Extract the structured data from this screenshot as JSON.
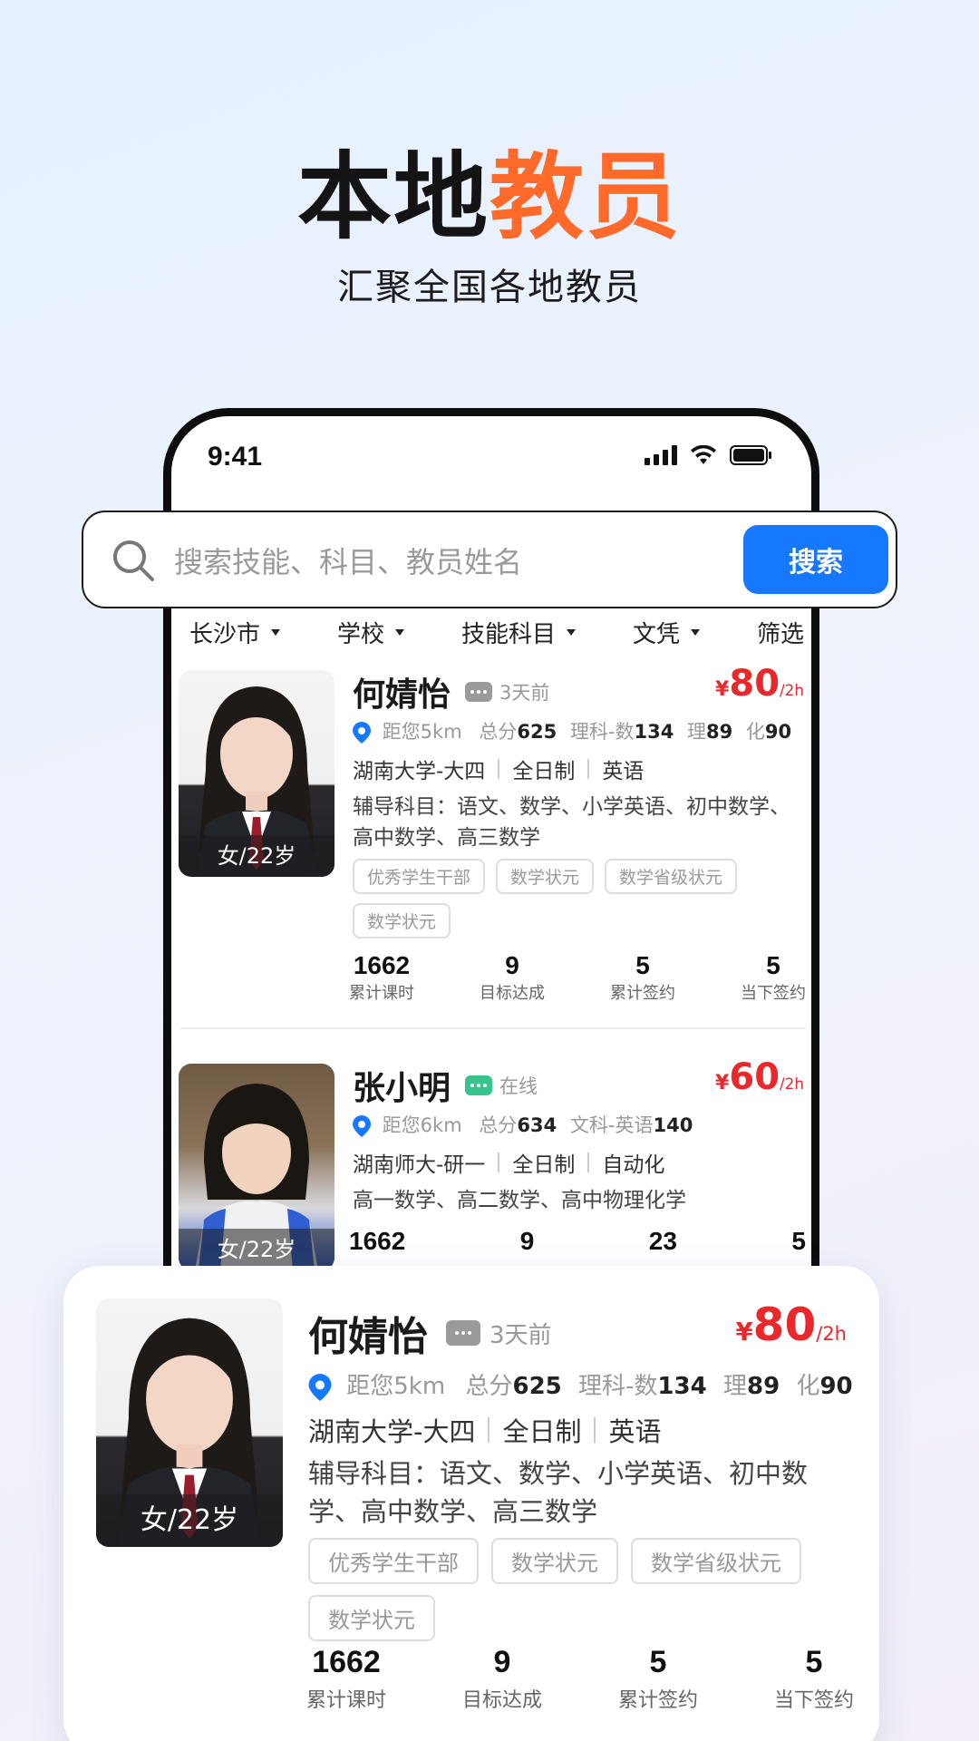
{
  "hero": {
    "title_dark": "本地",
    "title_accent": "教员",
    "subtitle": "汇聚全国各地教员"
  },
  "status_bar": {
    "time": "9:41"
  },
  "search": {
    "placeholder": "搜索技能、科目、教员姓名",
    "button_label": "搜索"
  },
  "filters": [
    "长沙市",
    "学校",
    "技能科目",
    "文凭",
    "筛选"
  ],
  "colors": {
    "accent": "#ff6a2b",
    "price": "#e8282b",
    "primary": "#1677ff",
    "online": "#35c48a"
  },
  "teachers": [
    {
      "photo_caption": "女/22岁",
      "name": "何婧怡",
      "status": "3天前",
      "status_icon": "chat-bubble-icon",
      "price_currency": "¥",
      "price_value": "80",
      "price_unit": "/2h",
      "distance": "距您5km",
      "score_label": "总分",
      "score": "625",
      "track_label": "理科-数",
      "track_score": "134",
      "sub1_label": "理",
      "sub1_score": "89",
      "sub2_label": "化",
      "sub2_score": "90",
      "school": "湖南大学-大四",
      "mode": "全日制",
      "major": "英语",
      "subjects": "辅导科目：语文、数学、小学英语、初中数学、高中数学、高三数学",
      "tags": [
        "优秀学生干部",
        "数学状元",
        "数学省级状元",
        "数学状元"
      ],
      "stats": [
        {
          "num": "1662",
          "label": "累计课时"
        },
        {
          "num": "9",
          "label": "目标达成"
        },
        {
          "num": "5",
          "label": "累计签约"
        },
        {
          "num": "5",
          "label": "当下签约"
        }
      ]
    },
    {
      "photo_caption": "女/22岁",
      "name": "张小明",
      "status": "在线",
      "status_icon": "chat-bubble-icon",
      "price_currency": "¥",
      "price_value": "60",
      "price_unit": "/2h",
      "distance": "距您6km",
      "score_label": "总分",
      "score": "634",
      "track_label": "文科-英语",
      "track_score": "140",
      "school": "湖南师大-研一",
      "mode": "全日制",
      "major": "自动化",
      "subjects": "高一数学、高二数学、高中物理化学",
      "stats": [
        {
          "num": "1662"
        },
        {
          "num": "9"
        },
        {
          "num": "23"
        },
        {
          "num": "5"
        }
      ]
    }
  ]
}
